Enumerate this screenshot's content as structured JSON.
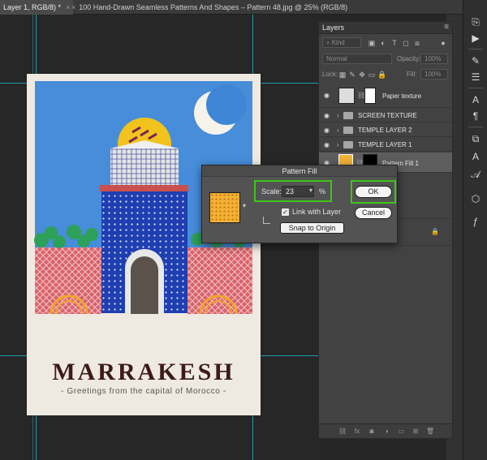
{
  "tabs": [
    {
      "label": "Layer 1, RGB/8) *"
    },
    {
      "label": "100 Hand-Drawn Seamless Patterns And Shapes – Pattern 48.jpg @ 25% (RGB/8)"
    }
  ],
  "poster": {
    "title": "MARRAKESH",
    "subtitle": "- Greetings from the capital of Morocco -"
  },
  "layers_panel": {
    "title": "Layers",
    "kind_filter": "Kind",
    "blend_mode": "Normal",
    "opacity_label": "Opacity:",
    "opacity_value": "100%",
    "lock_label": "Lock:",
    "fill_label": "Fill:",
    "fill_value": "100%",
    "layers": [
      {
        "name": "Paper texture",
        "type": "image"
      },
      {
        "name": "SCREEN TEXTURE",
        "type": "group"
      },
      {
        "name": "TEMPLE LAYER 2",
        "type": "group"
      },
      {
        "name": "TEMPLE  LAYER 1",
        "type": "group"
      },
      {
        "name": "Pattern Fill 1",
        "type": "fill",
        "selected": true
      }
    ]
  },
  "dialog": {
    "title": "Pattern Fill",
    "scale_label": "Scale:",
    "scale_value": "23",
    "scale_unit": "%",
    "link_label": "Link with Layer",
    "link_checked": true,
    "snap_label": "Snap to Origin",
    "ok_label": "OK",
    "cancel_label": "Cancel",
    "pattern_color": "#f3b233"
  },
  "colors": {
    "highlight": "#3ec51a",
    "guide": "#1fb3c7",
    "sky": "#3f86d6",
    "temple_blue": "#1f3eb0",
    "wall_pink": "#d9626c",
    "sun": "#f2c21d",
    "title_text": "#3d1a18"
  }
}
